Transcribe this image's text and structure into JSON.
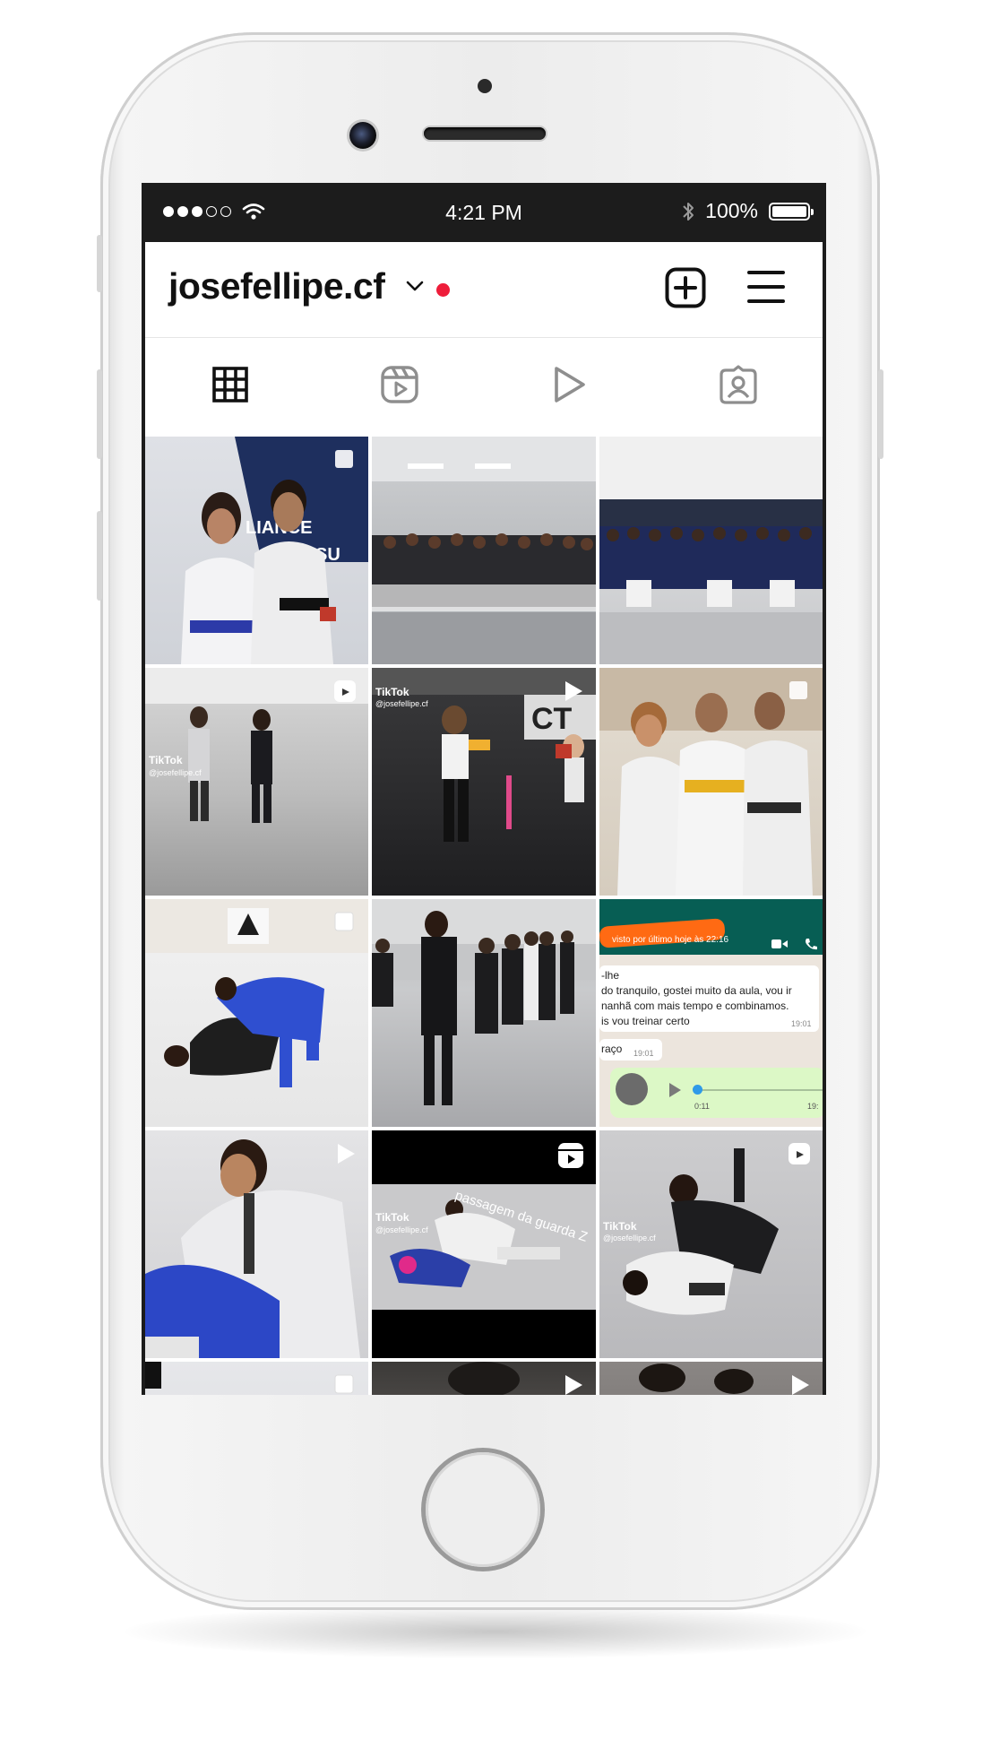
{
  "status_bar": {
    "time": "4:21 PM",
    "battery": "100%"
  },
  "profile": {
    "username": "josefellipe.cf"
  },
  "icons": {
    "signal": "signal-dots-icon",
    "wifi": "wifi-icon",
    "bluetooth": "bluetooth-icon",
    "battery": "battery-icon",
    "chevron": "chevron-down-icon",
    "create": "plus-square-icon",
    "menu": "hamburger-menu-icon",
    "tab_grid": "grid-icon",
    "tab_reels": "reels-icon",
    "tab_video": "play-icon",
    "tab_tagged": "tagged-person-icon"
  },
  "tabs": [
    "posts",
    "reels",
    "videos",
    "tagged"
  ],
  "active_tab": "posts",
  "overlays": {
    "tiktok": "TikTok",
    "handle": "@josefellipe.cf",
    "reel_caption": "passagem da guarda Z"
  },
  "chat_tile": {
    "status": "visto por último hoje às 22:16",
    "line1": "-lhe",
    "line2": "do tranquilo, gostei muito da aula, vou ir",
    "line3": "nanhã com mais tempo e combinamos.",
    "line4": "is vou treinar certo",
    "time1": "19:01",
    "msg2": "raço",
    "time2": "19:01",
    "audio_time": "0:11",
    "audio_end": "19:"
  },
  "colors": {
    "accent_red": "#ee1d3a",
    "text": "#111111",
    "icon_gray": "#8e8e8e"
  }
}
